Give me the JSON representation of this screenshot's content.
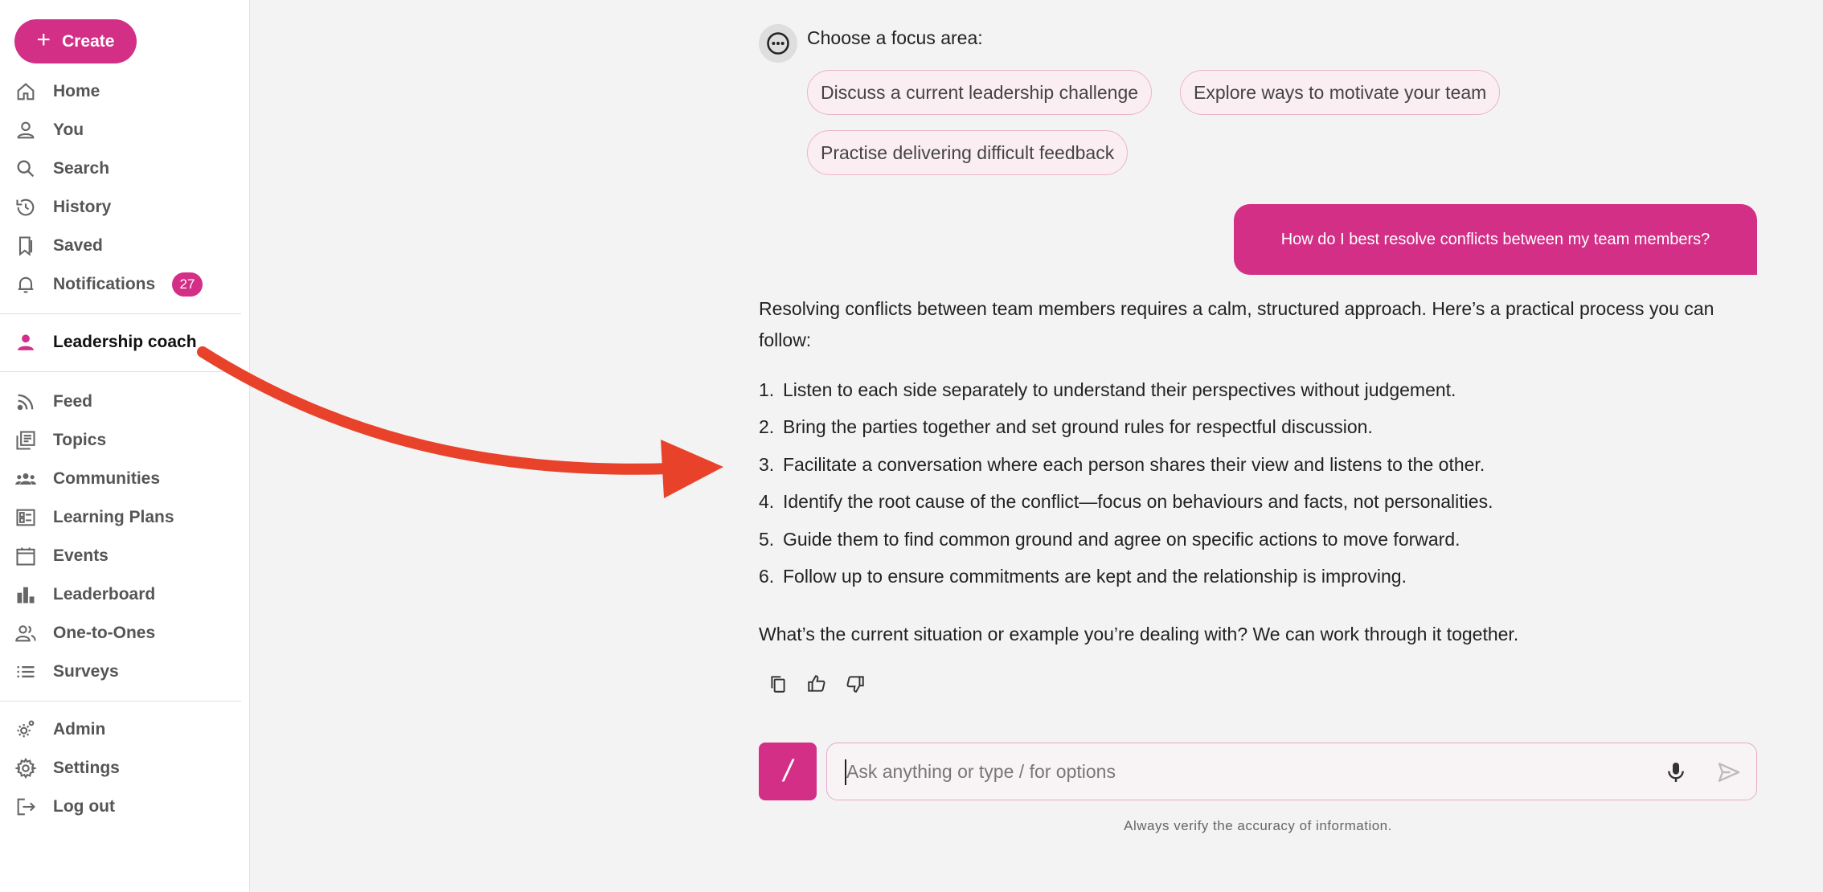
{
  "sidebar": {
    "create_label": "Create",
    "items": [
      {
        "label": "Home",
        "icon": "home-icon"
      },
      {
        "label": "You",
        "icon": "person-icon"
      },
      {
        "label": "Search",
        "icon": "search-icon"
      },
      {
        "label": "History",
        "icon": "history-icon"
      },
      {
        "label": "Saved",
        "icon": "bookmark-icon"
      },
      {
        "label": "Notifications",
        "icon": "bell-icon",
        "badge": "27"
      },
      {
        "label": "Leadership coach",
        "icon": "person-filled-icon",
        "active": true
      },
      {
        "label": "Feed",
        "icon": "rss-icon"
      },
      {
        "label": "Topics",
        "icon": "topics-icon"
      },
      {
        "label": "Communities",
        "icon": "groups-icon"
      },
      {
        "label": "Learning Plans",
        "icon": "learning-plan-icon"
      },
      {
        "label": "Events",
        "icon": "calendar-icon"
      },
      {
        "label": "Leaderboard",
        "icon": "bar-chart-icon"
      },
      {
        "label": "One-to-Ones",
        "icon": "people-icon"
      },
      {
        "label": "Surveys",
        "icon": "list-icon"
      },
      {
        "label": "Admin",
        "icon": "admin-gear-icon"
      },
      {
        "label": "Settings",
        "icon": "gear-icon"
      },
      {
        "label": "Log out",
        "icon": "logout-icon"
      }
    ]
  },
  "chat": {
    "focus_title": "Choose a focus area:",
    "chips": [
      "Discuss a current leadership challenge",
      "Explore ways to motivate your team",
      "Practise delivering difficult feedback"
    ],
    "user_message": "How do I best resolve conflicts between my team members?",
    "answer_intro": "Resolving conflicts between team members requires a calm, structured approach. Here’s a practical process you can follow:",
    "steps": [
      "Listen to each side separately to understand their perspectives without judgement.",
      "Bring the parties together and set ground rules for respectful discussion.",
      "Facilitate a conversation where each person shares their view and listens to the other.",
      "Identify the root cause of the conflict—focus on behaviours and facts, not personalities.",
      "Guide them to find common ground and agree on specific actions to move forward.",
      "Follow up to ensure commitments are kept and the relationship is improving."
    ],
    "step_numbers": [
      "1.",
      "2.",
      "3.",
      "4.",
      "5.",
      "6."
    ],
    "answer_outro": "What’s the current situation or example you’re dealing with? We can work through it together."
  },
  "composer": {
    "slash_label": "/",
    "placeholder": "Ask anything or type / for options",
    "value": "",
    "disclaimer": "Always verify the accuracy of information."
  },
  "colors": {
    "accent": "#d32f86",
    "arrow": "#e8432a",
    "chip_bg": "#fbeef3",
    "chip_border": "#e9b5cb",
    "background": "#f4f3f4"
  }
}
